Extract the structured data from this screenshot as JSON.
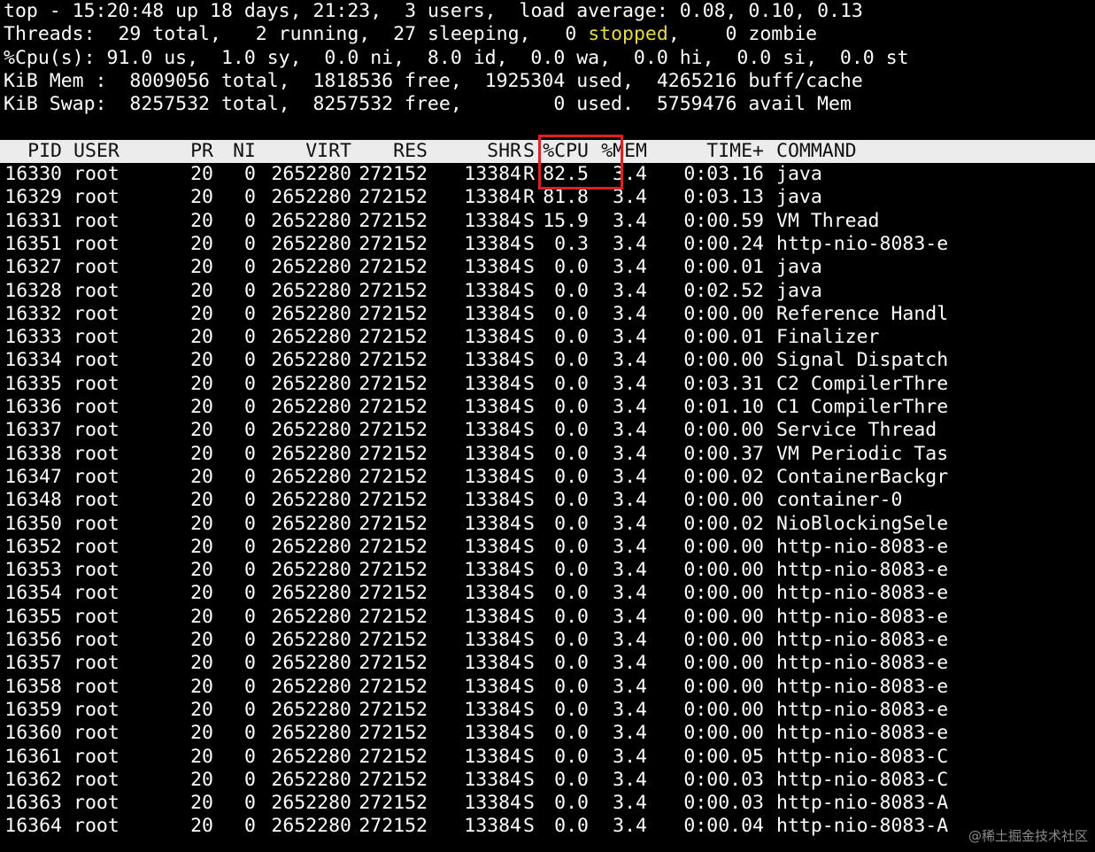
{
  "summary": {
    "top": {
      "prefix": "top - ",
      "time": "15:20:48",
      "uptime_text": " up 18 days, 21:23,  ",
      "users": "3 users,  ",
      "load_label": "load average: ",
      "load_values": "0.08, 0.10, 0.13"
    },
    "threads": {
      "label": "Threads:  ",
      "total": "29 total,   ",
      "running": "2 running,  ",
      "sleeping": "27 sleeping,   ",
      "stopped_count": "0 ",
      "stopped_word": "stopped",
      "zombie": ",    0 zombie"
    },
    "cpu": {
      "line": "%Cpu(s): 91.0 us,  1.0 sy,  0.0 ni,  8.0 id,  0.0 wa,  0.0 hi,  0.0 si,  0.0 st"
    },
    "mem": {
      "line": "KiB Mem :  8009056 total,  1818536 free,  1925304 used,  4265216 buff/cache"
    },
    "swap": {
      "line": "KiB Swap:  8257532 total,  8257532 free,        0 used.  5759476 avail Mem"
    }
  },
  "columns": {
    "pid": "PID",
    "user": "USER",
    "pr": "PR",
    "ni": "NI",
    "virt": "VIRT",
    "res": "RES",
    "shr": "SHR",
    "s": "S",
    "cpu": "%CPU",
    "mem": "%MEM",
    "time": "TIME+",
    "command": "COMMAND"
  },
  "rows": [
    {
      "pid": "16330",
      "user": "root",
      "pr": "20",
      "ni": "0",
      "virt": "2652280",
      "res": "272152",
      "shr": "13384",
      "s": "R",
      "cpu": "82.5",
      "mem": "3.4",
      "time": "0:03.16",
      "command": "java"
    },
    {
      "pid": "16329",
      "user": "root",
      "pr": "20",
      "ni": "0",
      "virt": "2652280",
      "res": "272152",
      "shr": "13384",
      "s": "R",
      "cpu": "81.8",
      "mem": "3.4",
      "time": "0:03.13",
      "command": "java"
    },
    {
      "pid": "16331",
      "user": "root",
      "pr": "20",
      "ni": "0",
      "virt": "2652280",
      "res": "272152",
      "shr": "13384",
      "s": "S",
      "cpu": "15.9",
      "mem": "3.4",
      "time": "0:00.59",
      "command": "VM Thread"
    },
    {
      "pid": "16351",
      "user": "root",
      "pr": "20",
      "ni": "0",
      "virt": "2652280",
      "res": "272152",
      "shr": "13384",
      "s": "S",
      "cpu": "0.3",
      "mem": "3.4",
      "time": "0:00.24",
      "command": "http-nio-8083-e"
    },
    {
      "pid": "16327",
      "user": "root",
      "pr": "20",
      "ni": "0",
      "virt": "2652280",
      "res": "272152",
      "shr": "13384",
      "s": "S",
      "cpu": "0.0",
      "mem": "3.4",
      "time": "0:00.01",
      "command": "java"
    },
    {
      "pid": "16328",
      "user": "root",
      "pr": "20",
      "ni": "0",
      "virt": "2652280",
      "res": "272152",
      "shr": "13384",
      "s": "S",
      "cpu": "0.0",
      "mem": "3.4",
      "time": "0:02.52",
      "command": "java"
    },
    {
      "pid": "16332",
      "user": "root",
      "pr": "20",
      "ni": "0",
      "virt": "2652280",
      "res": "272152",
      "shr": "13384",
      "s": "S",
      "cpu": "0.0",
      "mem": "3.4",
      "time": "0:00.00",
      "command": "Reference Handl"
    },
    {
      "pid": "16333",
      "user": "root",
      "pr": "20",
      "ni": "0",
      "virt": "2652280",
      "res": "272152",
      "shr": "13384",
      "s": "S",
      "cpu": "0.0",
      "mem": "3.4",
      "time": "0:00.01",
      "command": "Finalizer"
    },
    {
      "pid": "16334",
      "user": "root",
      "pr": "20",
      "ni": "0",
      "virt": "2652280",
      "res": "272152",
      "shr": "13384",
      "s": "S",
      "cpu": "0.0",
      "mem": "3.4",
      "time": "0:00.00",
      "command": "Signal Dispatch"
    },
    {
      "pid": "16335",
      "user": "root",
      "pr": "20",
      "ni": "0",
      "virt": "2652280",
      "res": "272152",
      "shr": "13384",
      "s": "S",
      "cpu": "0.0",
      "mem": "3.4",
      "time": "0:03.31",
      "command": "C2 CompilerThre"
    },
    {
      "pid": "16336",
      "user": "root",
      "pr": "20",
      "ni": "0",
      "virt": "2652280",
      "res": "272152",
      "shr": "13384",
      "s": "S",
      "cpu": "0.0",
      "mem": "3.4",
      "time": "0:01.10",
      "command": "C1 CompilerThre"
    },
    {
      "pid": "16337",
      "user": "root",
      "pr": "20",
      "ni": "0",
      "virt": "2652280",
      "res": "272152",
      "shr": "13384",
      "s": "S",
      "cpu": "0.0",
      "mem": "3.4",
      "time": "0:00.00",
      "command": "Service Thread"
    },
    {
      "pid": "16338",
      "user": "root",
      "pr": "20",
      "ni": "0",
      "virt": "2652280",
      "res": "272152",
      "shr": "13384",
      "s": "S",
      "cpu": "0.0",
      "mem": "3.4",
      "time": "0:00.37",
      "command": "VM Periodic Tas"
    },
    {
      "pid": "16347",
      "user": "root",
      "pr": "20",
      "ni": "0",
      "virt": "2652280",
      "res": "272152",
      "shr": "13384",
      "s": "S",
      "cpu": "0.0",
      "mem": "3.4",
      "time": "0:00.02",
      "command": "ContainerBackgr"
    },
    {
      "pid": "16348",
      "user": "root",
      "pr": "20",
      "ni": "0",
      "virt": "2652280",
      "res": "272152",
      "shr": "13384",
      "s": "S",
      "cpu": "0.0",
      "mem": "3.4",
      "time": "0:00.00",
      "command": "container-0"
    },
    {
      "pid": "16350",
      "user": "root",
      "pr": "20",
      "ni": "0",
      "virt": "2652280",
      "res": "272152",
      "shr": "13384",
      "s": "S",
      "cpu": "0.0",
      "mem": "3.4",
      "time": "0:00.02",
      "command": "NioBlockingSele"
    },
    {
      "pid": "16352",
      "user": "root",
      "pr": "20",
      "ni": "0",
      "virt": "2652280",
      "res": "272152",
      "shr": "13384",
      "s": "S",
      "cpu": "0.0",
      "mem": "3.4",
      "time": "0:00.00",
      "command": "http-nio-8083-e"
    },
    {
      "pid": "16353",
      "user": "root",
      "pr": "20",
      "ni": "0",
      "virt": "2652280",
      "res": "272152",
      "shr": "13384",
      "s": "S",
      "cpu": "0.0",
      "mem": "3.4",
      "time": "0:00.00",
      "command": "http-nio-8083-e"
    },
    {
      "pid": "16354",
      "user": "root",
      "pr": "20",
      "ni": "0",
      "virt": "2652280",
      "res": "272152",
      "shr": "13384",
      "s": "S",
      "cpu": "0.0",
      "mem": "3.4",
      "time": "0:00.00",
      "command": "http-nio-8083-e"
    },
    {
      "pid": "16355",
      "user": "root",
      "pr": "20",
      "ni": "0",
      "virt": "2652280",
      "res": "272152",
      "shr": "13384",
      "s": "S",
      "cpu": "0.0",
      "mem": "3.4",
      "time": "0:00.00",
      "command": "http-nio-8083-e"
    },
    {
      "pid": "16356",
      "user": "root",
      "pr": "20",
      "ni": "0",
      "virt": "2652280",
      "res": "272152",
      "shr": "13384",
      "s": "S",
      "cpu": "0.0",
      "mem": "3.4",
      "time": "0:00.00",
      "command": "http-nio-8083-e"
    },
    {
      "pid": "16357",
      "user": "root",
      "pr": "20",
      "ni": "0",
      "virt": "2652280",
      "res": "272152",
      "shr": "13384",
      "s": "S",
      "cpu": "0.0",
      "mem": "3.4",
      "time": "0:00.00",
      "command": "http-nio-8083-e"
    },
    {
      "pid": "16358",
      "user": "root",
      "pr": "20",
      "ni": "0",
      "virt": "2652280",
      "res": "272152",
      "shr": "13384",
      "s": "S",
      "cpu": "0.0",
      "mem": "3.4",
      "time": "0:00.00",
      "command": "http-nio-8083-e"
    },
    {
      "pid": "16359",
      "user": "root",
      "pr": "20",
      "ni": "0",
      "virt": "2652280",
      "res": "272152",
      "shr": "13384",
      "s": "S",
      "cpu": "0.0",
      "mem": "3.4",
      "time": "0:00.00",
      "command": "http-nio-8083-e"
    },
    {
      "pid": "16360",
      "user": "root",
      "pr": "20",
      "ni": "0",
      "virt": "2652280",
      "res": "272152",
      "shr": "13384",
      "s": "S",
      "cpu": "0.0",
      "mem": "3.4",
      "time": "0:00.00",
      "command": "http-nio-8083-e"
    },
    {
      "pid": "16361",
      "user": "root",
      "pr": "20",
      "ni": "0",
      "virt": "2652280",
      "res": "272152",
      "shr": "13384",
      "s": "S",
      "cpu": "0.0",
      "mem": "3.4",
      "time": "0:00.05",
      "command": "http-nio-8083-C"
    },
    {
      "pid": "16362",
      "user": "root",
      "pr": "20",
      "ni": "0",
      "virt": "2652280",
      "res": "272152",
      "shr": "13384",
      "s": "S",
      "cpu": "0.0",
      "mem": "3.4",
      "time": "0:00.03",
      "command": "http-nio-8083-C"
    },
    {
      "pid": "16363",
      "user": "root",
      "pr": "20",
      "ni": "0",
      "virt": "2652280",
      "res": "272152",
      "shr": "13384",
      "s": "S",
      "cpu": "0.0",
      "mem": "3.4",
      "time": "0:00.03",
      "command": "http-nio-8083-A"
    },
    {
      "pid": "16364",
      "user": "root",
      "pr": "20",
      "ni": "0",
      "virt": "2652280",
      "res": "272152",
      "shr": "13384",
      "s": "S",
      "cpu": "0.0",
      "mem": "3.4",
      "time": "0:00.04",
      "command": "http-nio-8083-A"
    }
  ],
  "watermark": "@稀土掘金技术社区",
  "colors": {
    "background": "#000000",
    "text": "#ffffff",
    "header_bg": "#ececec",
    "stopped": "#e6d94a",
    "highlight": "#e02020"
  }
}
